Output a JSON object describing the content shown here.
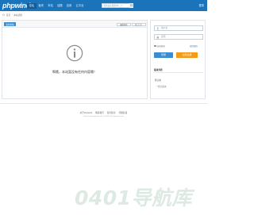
{
  "header": {
    "logo": "phpwind",
    "nav": [
      {
        "label": "论坛",
        "active": true
      },
      {
        "label": "板块",
        "active": false
      },
      {
        "label": "本站",
        "active": false
      },
      {
        "label": "话题",
        "active": false
      },
      {
        "label": "应用",
        "active": false
      },
      {
        "label": "云平台",
        "active": false
      }
    ],
    "search_placeholder": "搜索其实很简单(^_^)",
    "login_label": "登录"
  },
  "breadcrumb": {
    "home": "首页",
    "current": "本站话题"
  },
  "main": {
    "post_button": "发布新帖",
    "sort_a": "最新发帖",
    "sort_b": "最后回复",
    "empty_message": "啊哦，本站暂没有任何内容哦！"
  },
  "sidebar": {
    "username_placeholder": "用户名",
    "password_placeholder": "密码",
    "auto_login": "自动登录",
    "forgot": "找回密码",
    "login_button": "登录",
    "register_button": "立即注册",
    "section_title": "版块列表",
    "item": "默认类",
    "subitem": "一默认版块"
  },
  "footer": {
    "links": [
      "关于phpwind",
      "联系我们",
      "程序建议",
      "问题反馈"
    ],
    "copyright": "Powered by phpwind v9.0 ©2003-2013 phpwind.com"
  },
  "watermark": "0401导航库",
  "colors": {
    "brand": "#1b73b9",
    "primary_button": "#3b8dd0",
    "register_button": "#f39b17"
  }
}
